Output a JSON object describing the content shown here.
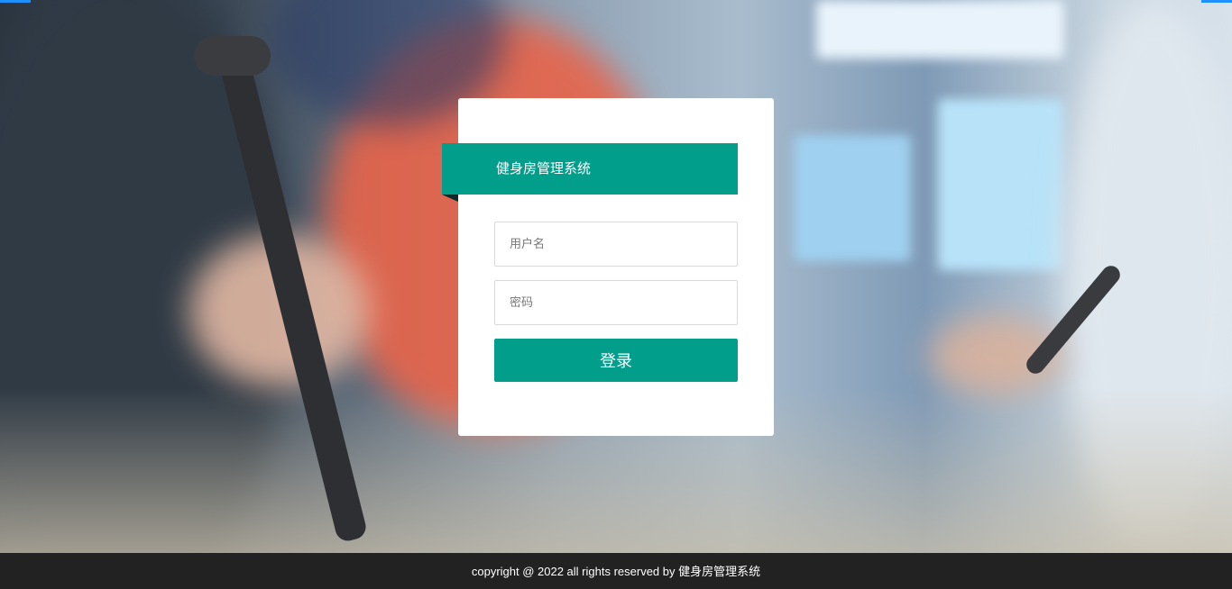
{
  "login": {
    "title": "健身房管理系统",
    "username_placeholder": "用户名",
    "password_placeholder": "密码",
    "submit_label": "登录"
  },
  "footer": {
    "copyright": "copyright @ 2022 all rights reserved by 健身房管理系统"
  },
  "colors": {
    "accent": "#009e8b",
    "footer_bg": "#222222",
    "corner_accent": "#1e90ff"
  }
}
